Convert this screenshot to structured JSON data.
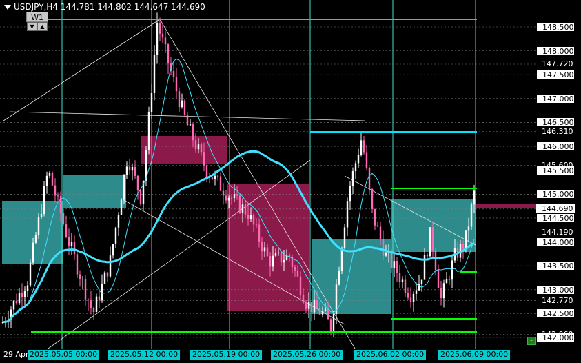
{
  "header": {
    "symbol_tf": "USDJPY,H4",
    "open": "144.781",
    "high": "144.802",
    "low": "144.647",
    "close": "144.690"
  },
  "tf_box": {
    "label": "W1",
    "down_btn": "▼",
    "up_btn": "▲"
  },
  "price_axis": [
    {
      "text": "148.500",
      "style": "box"
    },
    {
      "text": "148.000",
      "style": "box"
    },
    {
      "text": "147.720",
      "style": "plain"
    },
    {
      "text": "147.500",
      "style": "box"
    },
    {
      "text": "147.000",
      "style": "box"
    },
    {
      "text": "146.500",
      "style": "box"
    },
    {
      "text": "146.310",
      "style": "plain"
    },
    {
      "text": "146.000",
      "style": "box"
    },
    {
      "text": "145.600",
      "style": "plain"
    },
    {
      "text": "145.500",
      "style": "box"
    },
    {
      "text": "145.000",
      "style": "box"
    },
    {
      "text": "144.690",
      "style": "current"
    },
    {
      "text": "144.500",
      "style": "box"
    },
    {
      "text": "144.190",
      "style": "plain"
    },
    {
      "text": "144.000",
      "style": "box"
    },
    {
      "text": "143.500",
      "style": "box"
    },
    {
      "text": "143.000",
      "style": "box"
    },
    {
      "text": "142.770",
      "style": "plain"
    },
    {
      "text": "142.500",
      "style": "box"
    },
    {
      "text": "142.060",
      "style": "plain"
    },
    {
      "text": "142.000",
      "style": "box"
    }
  ],
  "time_axis": [
    {
      "text": "29 Apr",
      "style": "plain"
    },
    {
      "text": "2025.05.05 00:00",
      "style": "box"
    },
    {
      "text": "2025.05.12 00:00",
      "style": "box"
    },
    {
      "text": "2025.05.19 00:00",
      "style": "box"
    },
    {
      "text": "2025.05.26 00:00",
      "style": "box"
    },
    {
      "text": "2025.06.02 00:00",
      "style": "box"
    },
    {
      "text": "2025.06.09 00:00",
      "style": "box"
    }
  ],
  "corner_btn": "-",
  "colors": {
    "bull": "#ffffff",
    "bear": "#ff69b4",
    "ma_thick": "#40e0ff",
    "ma_thin": "#40e0ff",
    "level_green": "#00ff00",
    "level_cyan": "#00e5ff",
    "zone_teal": "#2e8b8b",
    "zone_maroon": "#8b1a4a",
    "vline": "#40e0d0",
    "hgrid": "#808080"
  }
}
